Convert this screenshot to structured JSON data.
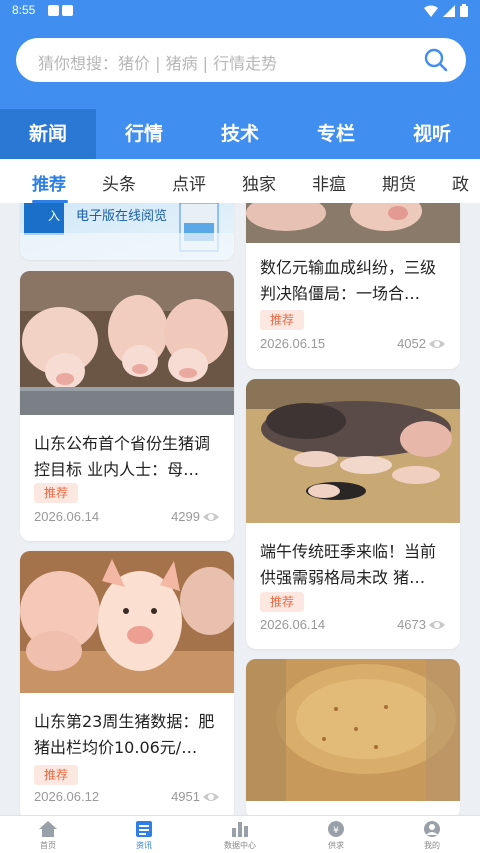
{
  "status": {
    "time": "8:55"
  },
  "search": {
    "placeholder": "猜你想搜：猪价 | 猪病 | 行情走势"
  },
  "tabs": [
    {
      "label": "新闻"
    },
    {
      "label": "行情"
    },
    {
      "label": "技术"
    },
    {
      "label": "专栏"
    },
    {
      "label": "视听"
    }
  ],
  "subtabs": [
    {
      "label": "推荐"
    },
    {
      "label": "头条"
    },
    {
      "label": "点评"
    },
    {
      "label": "独家"
    },
    {
      "label": "非瘟"
    },
    {
      "label": "期货"
    },
    {
      "label": "政"
    }
  ],
  "banner": {
    "text": "电子版在线阅览",
    "prefix": "入"
  },
  "cards": [
    {
      "title": "山东公布首个省份生猪调控目标 业内人士：母…",
      "tag": "推荐",
      "date": "2026.06.14",
      "views": "4299"
    },
    {
      "title": "山东第23周生猪数据：肥猪出栏均价10.06元/…",
      "tag": "推荐",
      "date": "2026.06.12",
      "views": "4951"
    },
    {
      "title": "数亿元输血成纠纷，三级判决陷僵局：一场合…",
      "tag": "推荐",
      "date": "2026.06.15",
      "views": "4052"
    },
    {
      "title": "端午传统旺季来临！当前供强需弱格局未改 猪…",
      "tag": "推荐",
      "date": "2026.06.14",
      "views": "4673"
    }
  ],
  "bottomnav": [
    {
      "label": "首页",
      "icon": "home-icon"
    },
    {
      "label": "资讯",
      "icon": "news-icon"
    },
    {
      "label": "数据中心",
      "icon": "chart-icon"
    },
    {
      "label": "供求",
      "icon": "supply-icon"
    },
    {
      "label": "我的",
      "icon": "user-icon"
    }
  ],
  "colors": {
    "primary": "#3f8ef0",
    "active_tab": "#2a77d4",
    "accent": "#2f80e6",
    "tag_bg": "#fde8e1",
    "tag_text": "#ec6a45"
  }
}
